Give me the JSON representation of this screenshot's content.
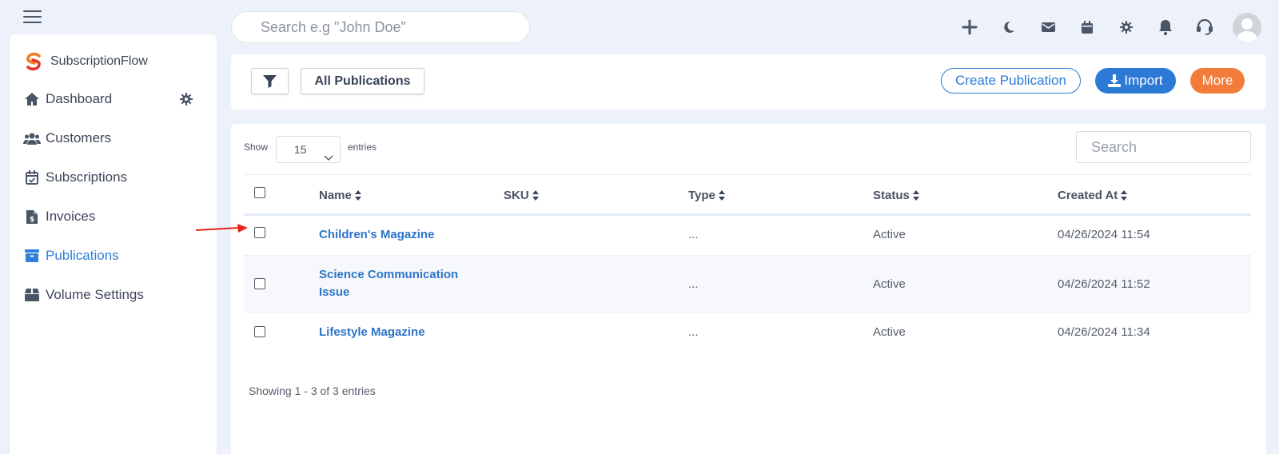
{
  "header": {
    "search_placeholder": "Search e.g \"John Doe\"",
    "icons": [
      "plus-icon",
      "moon-icon",
      "mail-icon",
      "calendar-icon",
      "gear-icon",
      "bell-icon",
      "headset-icon",
      "user-avatar"
    ]
  },
  "sidebar": {
    "brand": "SubscriptionFlow",
    "items": [
      {
        "label": "Dashboard",
        "icon": "home-icon"
      },
      {
        "label": "Customers",
        "icon": "users-icon"
      },
      {
        "label": "Subscriptions",
        "icon": "calendar-check-icon"
      },
      {
        "label": "Invoices",
        "icon": "invoice-icon"
      },
      {
        "label": "Publications",
        "icon": "archive-icon"
      },
      {
        "label": "Volume Settings",
        "icon": "box-icon"
      }
    ],
    "active": "Publications"
  },
  "toolbar": {
    "all_publications": "All Publications",
    "create": "Create Publication",
    "import": "Import",
    "more": "More"
  },
  "table": {
    "show_label": "Show",
    "entries_value": "15",
    "entries_label": "entries",
    "search_placeholder": "Search",
    "columns": [
      "Name",
      "SKU",
      "Type",
      "Status",
      "Created At"
    ],
    "rows": [
      {
        "name": "Children's Magazine",
        "sku": "",
        "type": "...",
        "status": "Active",
        "created": "04/26/2024 11:54"
      },
      {
        "name": "Science Communication Issue",
        "sku": "",
        "type": "...",
        "status": "Active",
        "created": "04/26/2024 11:52"
      },
      {
        "name": "Lifestyle Magazine",
        "sku": "",
        "type": "...",
        "status": "Active",
        "created": "04/26/2024 11:34"
      }
    ],
    "footer": "Showing 1 - 3 of 3 entries"
  },
  "colors": {
    "accent": "#2d7ad6",
    "more": "#f27d3a",
    "annotation_arrow": "#e8241a"
  }
}
